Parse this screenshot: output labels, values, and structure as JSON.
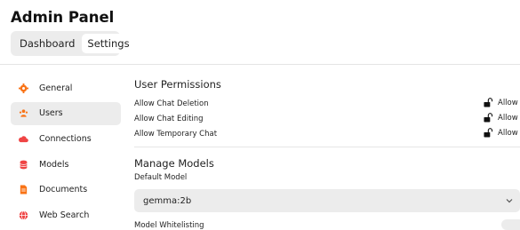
{
  "header": {
    "title": "Admin Panel"
  },
  "tabs": [
    {
      "label": "Dashboard",
      "active": false
    },
    {
      "label": "Settings",
      "active": true
    }
  ],
  "sidebar": {
    "items": [
      {
        "label": "General",
        "icon": "gear-icon",
        "color": "#f97316",
        "active": false
      },
      {
        "label": "Users",
        "icon": "users-icon",
        "color": "#f97316",
        "active": true
      },
      {
        "label": "Connections",
        "icon": "cloud-icon",
        "color": "#ef4444",
        "active": false
      },
      {
        "label": "Models",
        "icon": "database-icon",
        "color": "#ef4444",
        "active": false
      },
      {
        "label": "Documents",
        "icon": "document-icon",
        "color": "#f97316",
        "active": false
      },
      {
        "label": "Web Search",
        "icon": "globe-icon",
        "color": "#ef4444",
        "active": false
      }
    ]
  },
  "main": {
    "user_permissions": {
      "title": "User Permissions",
      "items": [
        {
          "label": "Allow Chat Deletion",
          "value": "Allow"
        },
        {
          "label": "Allow Chat Editing",
          "value": "Allow"
        },
        {
          "label": "Allow Temporary Chat",
          "value": "Allow"
        }
      ]
    },
    "manage_models": {
      "title": "Manage Models",
      "default_model_label": "Default Model",
      "default_model_value": "gemma:2b",
      "whitelist_label": "Model Whitelisting"
    }
  }
}
